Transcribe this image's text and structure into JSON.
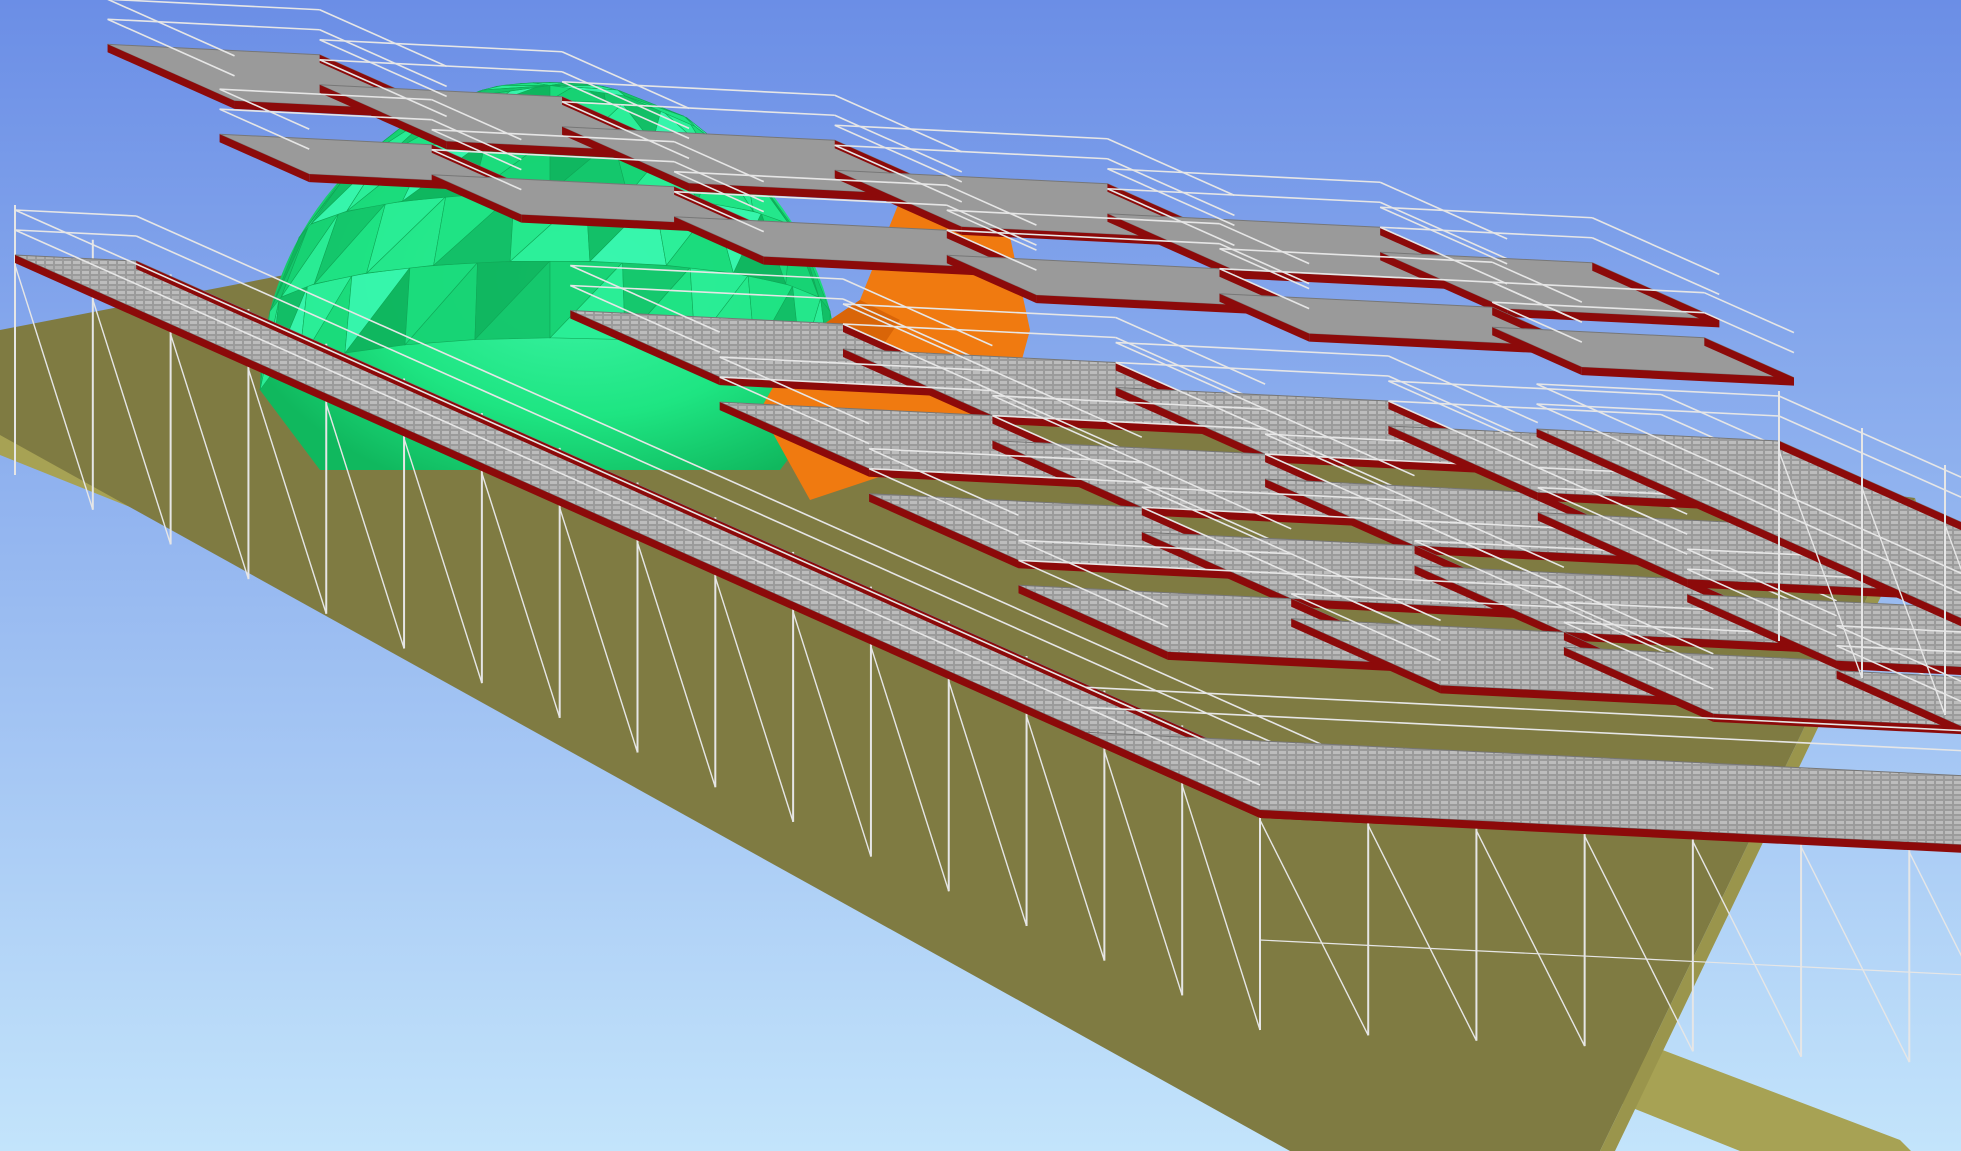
{
  "viewport": {
    "name": "3d-scaffolding-model-view"
  },
  "colors": {
    "sky_top": "#6b8ee6",
    "sky_bottom": "#c3e4fb",
    "ground_top": "#807c43",
    "ground_side": "#a9a356",
    "dome_light": "#3ff5a9",
    "dome_mid": "#1ee582",
    "dome_dark": "#10b85e",
    "wall_orange": "#f07a10",
    "deck_grey": "#9a9a9a",
    "deck_light": "#c4c4c4",
    "toeboard_red": "#8c0a0a",
    "tube_silver": "#e6e6e6"
  },
  "model": {
    "components": [
      "ground-plane",
      "geodesic-dome",
      "orange-wall",
      "scaffold-platforms",
      "guardrails",
      "standards",
      "diagonal-braces",
      "toeboards"
    ]
  }
}
